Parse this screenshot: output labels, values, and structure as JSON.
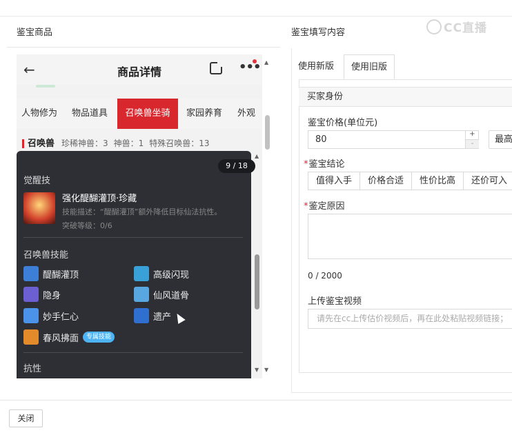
{
  "header": {
    "left_title": "鉴宝商品",
    "right_title": "鉴宝填写内容",
    "watermark": "CC直播"
  },
  "phone": {
    "title": "商品详情",
    "tabs": [
      "人物修为",
      "物品道具",
      "召唤兽坐骑",
      "家园养育",
      "外观"
    ],
    "active_tab": "召唤兽坐骑",
    "summon": {
      "label": "召唤兽",
      "stats": [
        "珍稀神兽：3",
        "神兽：1",
        "特殊召唤兽：13"
      ]
    },
    "overlay": {
      "counter": "9 / 18",
      "awaken_title": "觉醒技",
      "awaken_skill": {
        "name": "强化醍醐灌顶·珍藏",
        "desc": "技能描述：“醍醐灌顶”额外降低目标仙法抗性。",
        "level": "突破等级：0/6"
      },
      "pet_skills_title": "召唤兽技能",
      "pet_skills": [
        {
          "name": "醍醐灌顶",
          "icon": "blue-spark-icon",
          "color": "#3d7fd6"
        },
        {
          "name": "高级闪现",
          "icon": "blue-flash-icon",
          "color": "#3aa0d8"
        },
        {
          "name": "隐身",
          "icon": "purple-stealth-icon",
          "color": "#6c5fd1"
        },
        {
          "name": "仙风道骨",
          "icon": "blue-immortal-icon",
          "color": "#58a7e0"
        },
        {
          "name": "妙手仁心",
          "icon": "blue-heal-icon",
          "color": "#4a93e8"
        },
        {
          "name": "遗产",
          "icon": "blue-legacy-icon",
          "color": "#2f6fd0"
        },
        {
          "name": "春风拂面",
          "icon": "fire-wind-icon",
          "color": "#e38a2a",
          "badge": "专属技能"
        }
      ],
      "resist_title": "抗性"
    }
  },
  "form": {
    "tabs": [
      "使用新版",
      "使用旧版"
    ],
    "active_tab": "使用旧版",
    "section_title": "买家身份",
    "price_label": "鉴宝价格(单位元)",
    "price_value": "80",
    "max_label": "最高",
    "conclusion_label": "鉴宝结论",
    "conclusion_options": [
      "值得入手",
      "价格合适",
      "性价比高",
      "还价可入"
    ],
    "reason_label": "鉴定原因",
    "reason_count": "0 / 2000",
    "video_label": "上传鉴宝视频",
    "video_placeholder": "请先在cc上传估价视频后，再在此处粘贴视频链接；"
  },
  "footer": {
    "close_label": "关闭"
  }
}
